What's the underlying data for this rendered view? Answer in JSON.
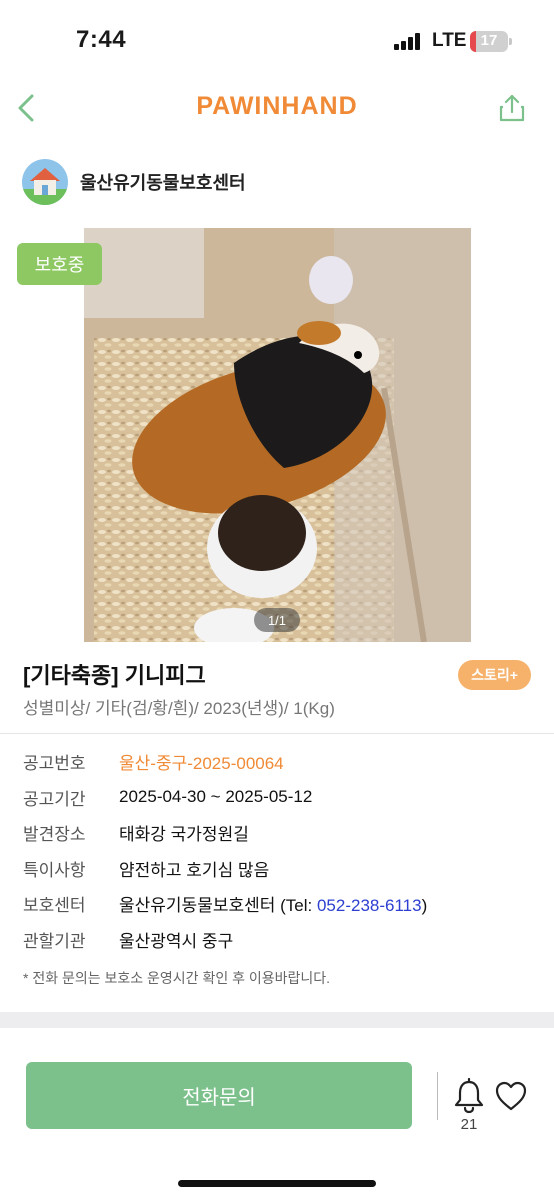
{
  "status_bar": {
    "time": "7:44",
    "network": "LTE",
    "battery_level": 17,
    "battery_text": "17",
    "battery_color": "#e5484d"
  },
  "nav": {
    "title": "PAWINHAND",
    "brand_color": "#f08a36",
    "back_icon": "chevron-left-icon",
    "share_icon": "share-icon",
    "icon_color": "#7cc08b"
  },
  "shelter": {
    "name": "울산유기동물보호센터",
    "avatar_icon": "house-icon"
  },
  "photo": {
    "status_badge": "보호중",
    "page_indicator": "1/1"
  },
  "animal": {
    "title": "[기타축종] 기니피그",
    "summary": "성별미상/ 기타(검/황/흰)/ 2023(년생)/ 1(Kg)",
    "story_button": "스토리+"
  },
  "info": {
    "notice_no": {
      "label": "공고번호",
      "value": "울산-중구-2025-00064"
    },
    "notice_period": {
      "label": "공고기간",
      "value": "2025-04-30 ~ 2025-05-12"
    },
    "found_place": {
      "label": "발견장소",
      "value": "태화강 국가정원길"
    },
    "special_notes": {
      "label": "특이사항",
      "value": "얌전하고 호기심 많음"
    },
    "shelter": {
      "label": "보호센터",
      "value": "울산유기동물보호센터",
      "tel_prefix": " (Tel: ",
      "tel": "052-238-6113",
      "tel_suffix": ")"
    },
    "jurisdiction": {
      "label": "관할기관",
      "value": "울산광역시 중구"
    }
  },
  "note": "* 전화 문의는 보호소 운영시간 확인 후 이용바랍니다.",
  "bottom_bar": {
    "call_button": "전화문의",
    "bell_icon": "bell-icon",
    "bell_count": "21",
    "heart_icon": "heart-icon"
  }
}
